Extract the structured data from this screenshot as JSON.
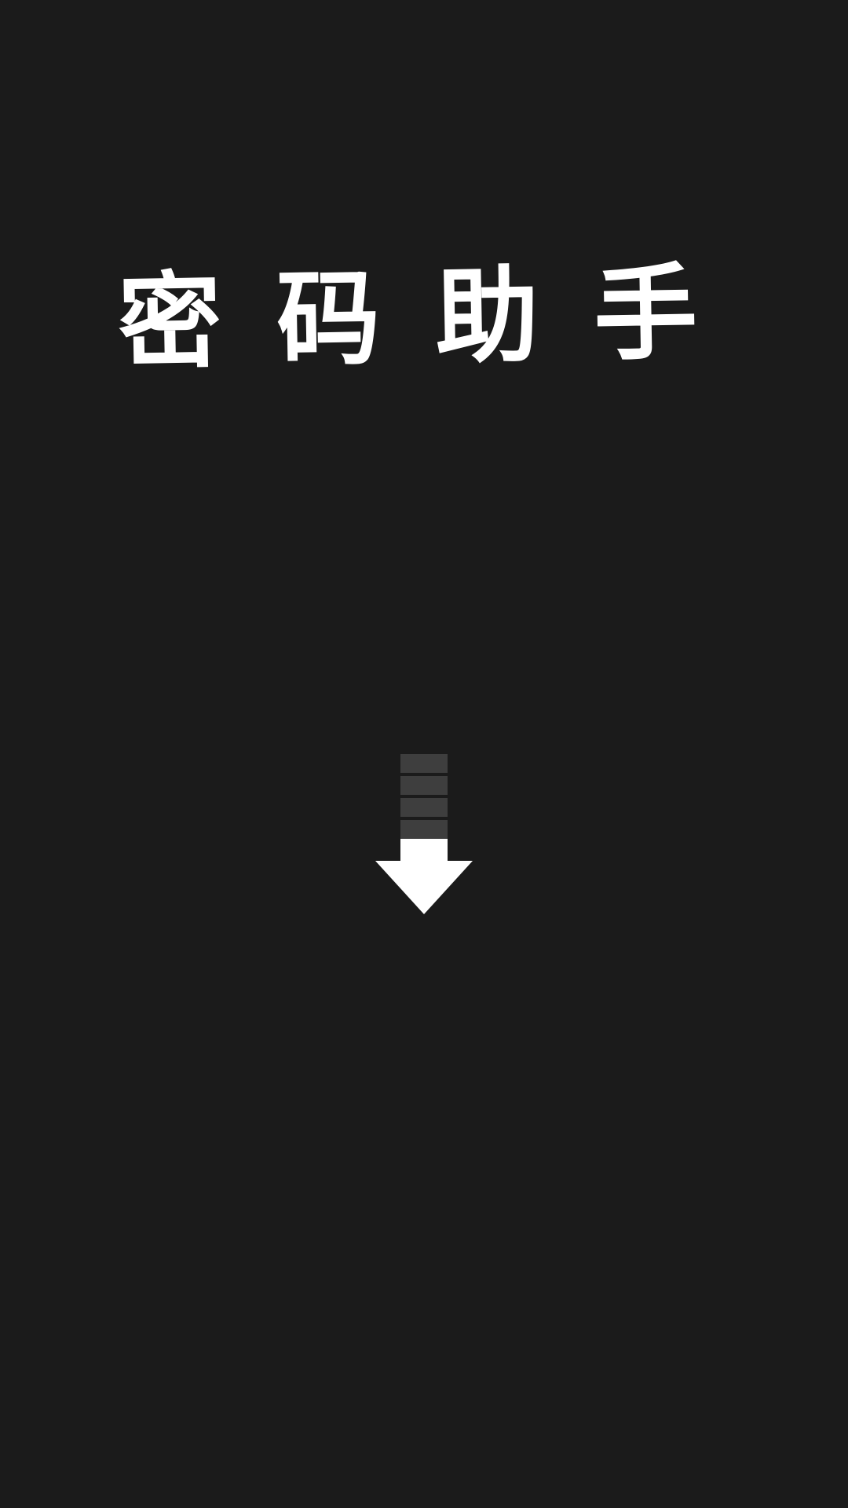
{
  "app": {
    "title": "密码助手",
    "logo_style": "hand-drawn white strokes on dark background"
  },
  "indicator": {
    "icon": "arrow-down-icon",
    "steps": 4,
    "arrow_color": "#ffffff",
    "step_color": "#3e3e3e"
  },
  "colors": {
    "background": "#1b1b1b",
    "text": "#ffffff"
  }
}
